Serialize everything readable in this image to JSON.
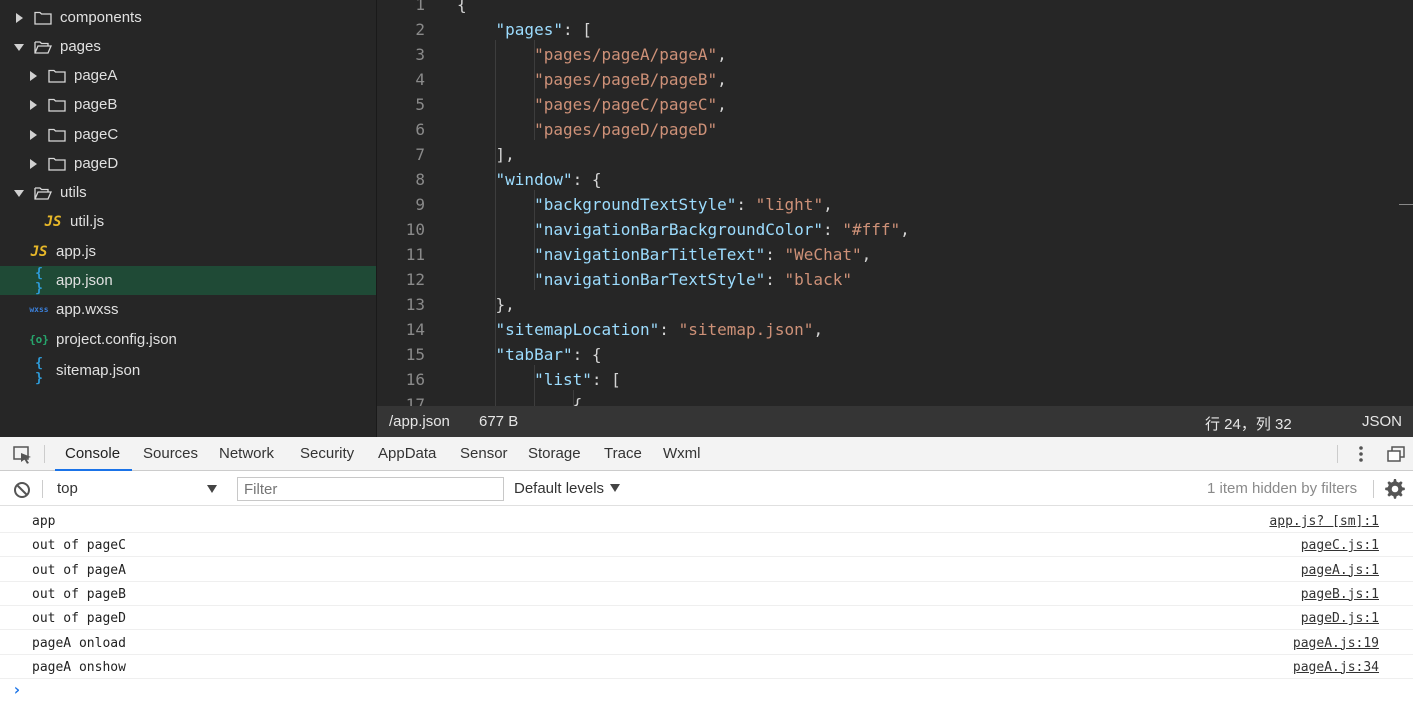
{
  "explorer": {
    "items": [
      {
        "label": "components",
        "type": "folder",
        "state": "collapsed",
        "icon": "folder-icon"
      },
      {
        "label": "pages",
        "type": "folder",
        "state": "expanded",
        "icon": "folder-open-icon"
      },
      {
        "label": "pageA",
        "type": "folder",
        "state": "collapsed",
        "icon": "folder-icon"
      },
      {
        "label": "pageB",
        "type": "folder",
        "state": "collapsed",
        "icon": "folder-icon"
      },
      {
        "label": "pageC",
        "type": "folder",
        "state": "collapsed",
        "icon": "folder-icon"
      },
      {
        "label": "pageD",
        "type": "folder",
        "state": "collapsed",
        "icon": "folder-icon"
      },
      {
        "label": "utils",
        "type": "folder",
        "state": "expanded",
        "icon": "folder-open-icon"
      },
      {
        "label": "util.js",
        "type": "file",
        "badge": "JS",
        "icon": "js-file-icon"
      },
      {
        "label": "app.js",
        "type": "file",
        "badge": "JS",
        "icon": "js-file-icon"
      },
      {
        "label": "app.json",
        "type": "file",
        "badge": "{ }",
        "icon": "json-file-icon",
        "selected": true
      },
      {
        "label": "app.wxss",
        "type": "file",
        "badge": "wxss",
        "icon": "wxss-file-icon"
      },
      {
        "label": "project.config.json",
        "type": "file",
        "badge": "{o}",
        "icon": "config-file-icon"
      },
      {
        "label": "sitemap.json",
        "type": "file",
        "badge": "{ }",
        "icon": "json-file-icon"
      }
    ],
    "selected_color": "#1f4a36"
  },
  "editor": {
    "lines": [
      {
        "n": "1",
        "text": "{"
      },
      {
        "n": "2",
        "text": "    \"pages\": ["
      },
      {
        "n": "3",
        "text": "        \"pages/pageA/pageA\","
      },
      {
        "n": "4",
        "text": "        \"pages/pageB/pageB\","
      },
      {
        "n": "5",
        "text": "        \"pages/pageC/pageC\","
      },
      {
        "n": "6",
        "text": "        \"pages/pageD/pageD\""
      },
      {
        "n": "7",
        "text": "    ],"
      },
      {
        "n": "8",
        "text": "    \"window\": {"
      },
      {
        "n": "9",
        "text": "        \"backgroundTextStyle\": \"light\","
      },
      {
        "n": "10",
        "text": "        \"navigationBarBackgroundColor\": \"#fff\","
      },
      {
        "n": "11",
        "text": "        \"navigationBarTitleText\": \"WeChat\","
      },
      {
        "n": "12",
        "text": "        \"navigationBarTextStyle\": \"black\""
      },
      {
        "n": "13",
        "text": "    },"
      },
      {
        "n": "14",
        "text": "    \"sitemapLocation\": \"sitemap.json\","
      },
      {
        "n": "15",
        "text": "    \"tabBar\": {"
      },
      {
        "n": "16",
        "text": "        \"list\": ["
      },
      {
        "n": "17",
        "text": "            {"
      }
    ],
    "colors": {
      "key": "#9cdcfe",
      "string": "#ce9178",
      "punct": "#d4d4d4",
      "line_number": "#8a8a8a",
      "background": "#262626"
    }
  },
  "status_bar": {
    "path": "/app.json",
    "size": "677 B",
    "cursor": "行 24，列 32",
    "language": "JSON"
  },
  "devtools": {
    "tabs": [
      "Console",
      "Sources",
      "Network",
      "Security",
      "AppData",
      "Sensor",
      "Storage",
      "Trace",
      "Wxml"
    ],
    "active_tab": "Console",
    "context": "top",
    "filter_placeholder": "Filter",
    "levels": "Default levels",
    "hidden_info": "1 item hidden by filters",
    "accent": "#1a73e8",
    "logs": [
      {
        "message": "app",
        "source": "app.js? [sm]:1"
      },
      {
        "message": "out of pageC",
        "source": "pageC.js:1"
      },
      {
        "message": "out of pageA",
        "source": "pageA.js:1"
      },
      {
        "message": "out of pageB",
        "source": "pageB.js:1"
      },
      {
        "message": "out of pageD",
        "source": "pageD.js:1"
      },
      {
        "message": "pageA onload",
        "source": "pageA.js:19"
      },
      {
        "message": "pageA onshow",
        "source": "pageA.js:34"
      }
    ],
    "prompt": "›"
  }
}
